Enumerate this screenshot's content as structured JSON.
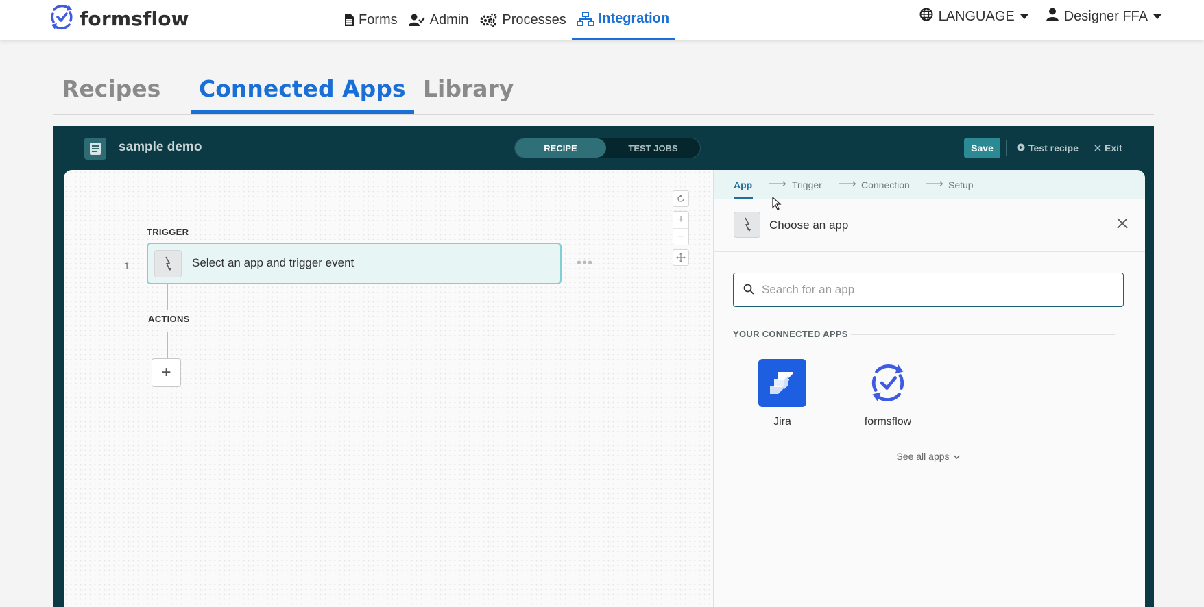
{
  "brand": {
    "name": "formsflow"
  },
  "nav": {
    "items": [
      {
        "label": "Forms",
        "icon": "file-icon",
        "active": false
      },
      {
        "label": "Admin",
        "icon": "user-check-icon",
        "active": false
      },
      {
        "label": "Processes",
        "icon": "cogs-icon",
        "active": false
      },
      {
        "label": "Integration",
        "icon": "sitemap-icon",
        "active": true
      }
    ],
    "language": "LANGUAGE",
    "user": "Designer FFA"
  },
  "tabs": [
    "Recipes",
    "Connected Apps",
    "Library"
  ],
  "active_tab": "Connected Apps",
  "editor": {
    "recipe_name": "sample demo",
    "modes": [
      "RECIPE",
      "TEST JOBS"
    ],
    "active_mode": "RECIPE",
    "save_label": "Save",
    "test_label": "Test recipe",
    "exit_label": "Exit",
    "canvas": {
      "trigger_label": "TRIGGER",
      "step_number": "1",
      "trigger_text": "Select an app and trigger event",
      "actions_label": "ACTIONS",
      "add_label": "+"
    },
    "panel": {
      "steps": [
        "App",
        "Trigger",
        "Connection",
        "Setup"
      ],
      "active_step": "App",
      "choose_text": "Choose an app",
      "search_placeholder": "Search for an app",
      "search_value": "",
      "connected_title": "YOUR CONNECTED APPS",
      "apps": [
        {
          "name": "Jira",
          "icon": "jira-icon",
          "color": "#1d5fe0"
        },
        {
          "name": "formsflow",
          "icon": "formsflow-logo-icon",
          "color": "#3b5bdb"
        }
      ],
      "see_all": "See all apps"
    }
  },
  "colors": {
    "accent": "#1a6fd6",
    "editor_bg": "#0b3a44",
    "save_bg": "#2b8a94",
    "trigger_border": "#7fcfd3"
  }
}
